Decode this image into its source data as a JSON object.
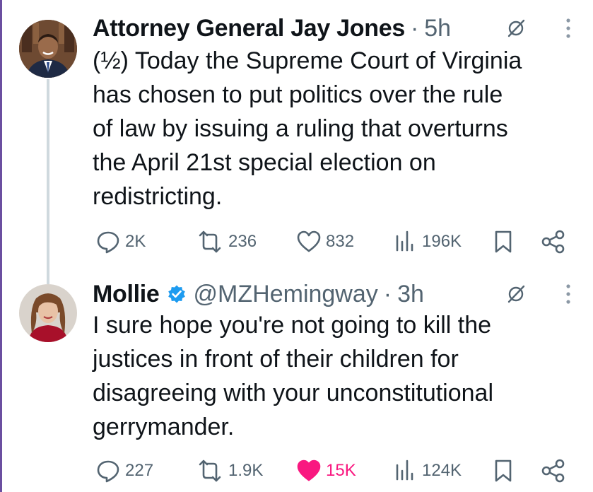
{
  "colors": {
    "text_primary": "#0f1419",
    "text_secondary": "#536471",
    "verified_blue": "#1d9bf0",
    "like_active": "#f91880",
    "thread_line": "#cfd9de"
  },
  "tweets": [
    {
      "author_name": "Attorney General Jay Jones",
      "verified": false,
      "handle": "",
      "separator": "·",
      "time": "5h",
      "text": "(½) Today the Supreme Court of Virginia\nhas chosen to put politics over the rule\nof law by issuing a ruling that overturns\nthe April 21st special election on\nredistricting.",
      "replies": "2K",
      "reposts": "236",
      "likes": "832",
      "liked": false,
      "views": "196K"
    },
    {
      "author_name": "Mollie",
      "verified": true,
      "handle": "@MZHemingway",
      "separator": "·",
      "time": "3h",
      "text": "I sure hope you're not going to kill the\njustices in front of their children for\ndisagreeing with your unconstitutional\ngerrymander.",
      "replies": "227",
      "reposts": "1.9K",
      "likes": "15K",
      "liked": true,
      "views": "124K"
    }
  ]
}
